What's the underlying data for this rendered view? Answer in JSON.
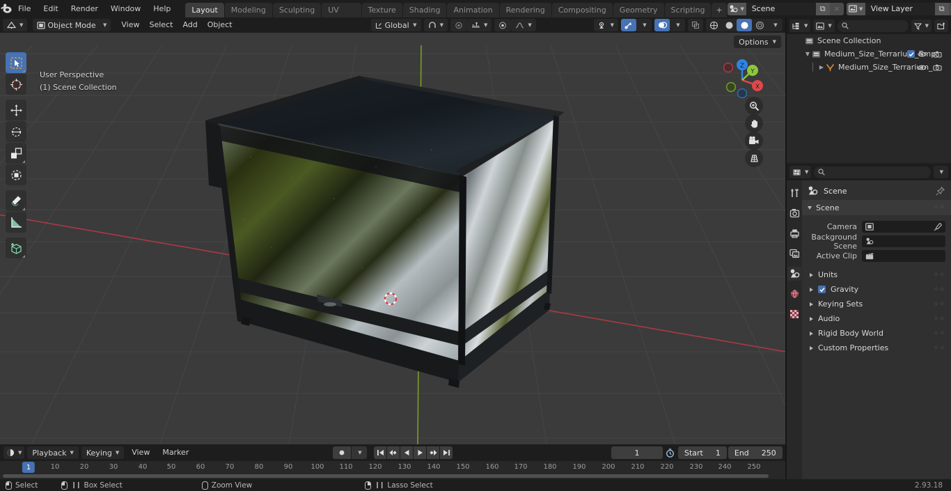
{
  "app": {
    "version": "2.93.18",
    "title": "Blender"
  },
  "topbar": {
    "logo_icon": "blender-logo-icon",
    "menus": [
      "File",
      "Edit",
      "Render",
      "Window",
      "Help"
    ],
    "workspace_tabs": [
      {
        "label": "Layout",
        "active": true
      },
      {
        "label": "Modeling",
        "active": false
      },
      {
        "label": "Sculpting",
        "active": false
      },
      {
        "label": "UV Editing",
        "active": false
      },
      {
        "label": "Texture Paint",
        "active": false
      },
      {
        "label": "Shading",
        "active": false
      },
      {
        "label": "Animation",
        "active": false
      },
      {
        "label": "Rendering",
        "active": false
      },
      {
        "label": "Compositing",
        "active": false
      },
      {
        "label": "Geometry Nodes",
        "active": false
      },
      {
        "label": "Scripting",
        "active": false
      }
    ],
    "add_workspace_label": "+",
    "scene_block": {
      "icon": "scene-icon",
      "name": "Scene",
      "new_label": "⧉",
      "unlink_label": "×"
    },
    "viewlayer_block": {
      "icon": "view-layer-icon",
      "name": "View Layer",
      "new_label": "⧉",
      "unlink_label": "×"
    }
  },
  "viewport": {
    "header": {
      "editor_type_icon": "editor-type-3dview-icon",
      "mode": "Object Mode",
      "mode_icon": "object-mode-icon",
      "menus": [
        "View",
        "Select",
        "Add",
        "Object"
      ],
      "select_modes": [
        "set",
        "extend",
        "subtract",
        "invert",
        "intersect"
      ],
      "transform_orientation": "Global",
      "transform_orientation_icon": "orientation-icon",
      "snap_icon": "magnet-icon",
      "snap_target_icon": "snap-increment-icon",
      "proportional_icon": "proportional-edit-icon",
      "falloff_icon": "falloff-smooth-icon",
      "visibility_icon": "visibility-icon",
      "gizmo_icon": "gizmo-icon",
      "overlays_icon": "overlays-icon",
      "xray_icon": "xray-icon",
      "shading_modes": [
        "wireframe",
        "solid",
        "material-preview",
        "rendered"
      ],
      "shading_active": "material-preview",
      "options_label": "Options"
    },
    "overlay_text": {
      "line1": "User Perspective",
      "line2": "(1) Scene Collection"
    },
    "toolbar": [
      {
        "name": "tweak-select-box",
        "label": "Select Box",
        "active": true
      },
      {
        "name": "cursor",
        "label": "Cursor",
        "active": false
      },
      {
        "name": "move",
        "label": "Move",
        "active": false
      },
      {
        "name": "rotate",
        "label": "Rotate",
        "active": false
      },
      {
        "name": "scale",
        "label": "Scale",
        "active": false
      },
      {
        "name": "transform",
        "label": "Transform",
        "active": false
      },
      {
        "name": "annotate",
        "label": "Annotate",
        "active": false
      },
      {
        "name": "measure",
        "label": "Measure",
        "active": false
      },
      {
        "name": "add-cube",
        "label": "Add Cube",
        "active": false
      }
    ],
    "gizmo": {
      "axes": [
        "X",
        "Y",
        "Z"
      ],
      "colors": {
        "x": "#e0484b",
        "y": "#8cc73e",
        "z": "#2f83e3"
      }
    },
    "nav_buttons": [
      "zoom-icon",
      "pan-hand-icon",
      "camera-view-icon",
      "toggle-perspective-icon"
    ],
    "scene_object": {
      "label": "Medium Size Terrarium",
      "frame_color": "#1e2022",
      "glass_green": "#3d4a1f",
      "glass_light": "#c8d0d6"
    },
    "cursor_3d": "3d-cursor-icon"
  },
  "outliner": {
    "display_mode_icon": "outliner-display-mode-icon",
    "filter_id_icon": "outliner-id-filter-icon",
    "search_placeholder": "",
    "search_value": "",
    "filter_icon": "filter-funnel-icon",
    "new_collection_icon": "new-collection-icon",
    "rows": [
      {
        "label": "Scene Collection",
        "indent": 0,
        "icon": "collection-icon",
        "disclosure": "",
        "checkbox": false,
        "eye": false,
        "camera": false
      },
      {
        "label": "Medium_Size_Terrarium_Emp",
        "indent": 1,
        "icon": "collection-icon",
        "disclosure": "▼",
        "checkbox": true,
        "eye": true,
        "camera": true
      },
      {
        "label": "Medium_Size_Terrarium_",
        "indent": 2,
        "icon": "mesh-object-icon",
        "disclosure": "▶",
        "checkbox": false,
        "eye": true,
        "camera": true
      }
    ]
  },
  "properties": {
    "editor_icon": "properties-editor-icon",
    "search_placeholder": "",
    "search_value": "",
    "dropdown_icon": "chevron-down-icon",
    "tabs": [
      {
        "name": "tool",
        "icon": "tool-icon",
        "active": false,
        "color": "#c8c8c8"
      },
      {
        "name": "render",
        "icon": "render-camera-icon",
        "active": false,
        "color": "#c8c8c8"
      },
      {
        "name": "output",
        "icon": "output-printer-icon",
        "active": false,
        "color": "#c8c8c8"
      },
      {
        "name": "view-layer",
        "icon": "view-layer-images-icon",
        "active": false,
        "color": "#c8c8c8"
      },
      {
        "name": "scene",
        "icon": "scene-cone-icon",
        "active": true,
        "color": "#d8d8d8"
      },
      {
        "name": "world",
        "icon": "world-globe-icon",
        "active": false,
        "color": "#d4697a"
      },
      {
        "name": "texture",
        "icon": "texture-checker-icon",
        "active": false,
        "color": "#d4697a"
      }
    ],
    "id_name": "Scene",
    "id_icon": "scene-cone-icon",
    "pin_icon": "pin-icon",
    "panel_title": "Scene",
    "fields": [
      {
        "label": "Camera",
        "value": "",
        "icon": "camera-data-icon",
        "eyedropper": true
      },
      {
        "label": "Background Scene",
        "value": "",
        "icon": "scene-cone-icon",
        "eyedropper": false
      },
      {
        "label": "Active Clip",
        "value": "",
        "icon": "movie-clip-icon",
        "eyedropper": false
      }
    ],
    "sections": [
      {
        "label": "Units",
        "checkbox": false,
        "open": false
      },
      {
        "label": "Gravity",
        "checkbox": true,
        "open": false
      },
      {
        "label": "Keying Sets",
        "checkbox": false,
        "open": false
      },
      {
        "label": "Audio",
        "checkbox": false,
        "open": false
      },
      {
        "label": "Rigid Body World",
        "checkbox": false,
        "open": false
      },
      {
        "label": "Custom Properties",
        "checkbox": false,
        "open": false
      }
    ]
  },
  "timeline": {
    "editor_icon": "timeline-editor-icon",
    "menus": [
      "Playback",
      "Keying",
      "View",
      "Marker"
    ],
    "record_icon": "record-icon",
    "transport": [
      "jump-to-start-icon",
      "jump-to-prev-keyframe-icon",
      "play-reverse-icon",
      "play-icon",
      "jump-to-next-keyframe-icon",
      "jump-to-end-icon"
    ],
    "current_frame": "1",
    "use_preview_range_icon": "preview-range-icon",
    "start_label": "Start",
    "start_value": "1",
    "end_label": "End",
    "end_value": "250",
    "playhead_frame": "1",
    "ruler_ticks": [
      10,
      20,
      30,
      40,
      50,
      60,
      70,
      80,
      90,
      100,
      110,
      120,
      130,
      140,
      150,
      160,
      170,
      180,
      190,
      200,
      210,
      220,
      230,
      240,
      250
    ]
  },
  "statusbar": {
    "items": [
      {
        "icon": "mouse-left-icon",
        "label": "Select"
      },
      {
        "icon": "mouse-left-drag-icon",
        "label": "Box Select"
      },
      {
        "icon": "mouse-middle-icon",
        "label": "Zoom View"
      },
      {
        "icon": "mouse-right-drag-icon",
        "label": "Lasso Select"
      }
    ],
    "version": "2.93.18"
  }
}
